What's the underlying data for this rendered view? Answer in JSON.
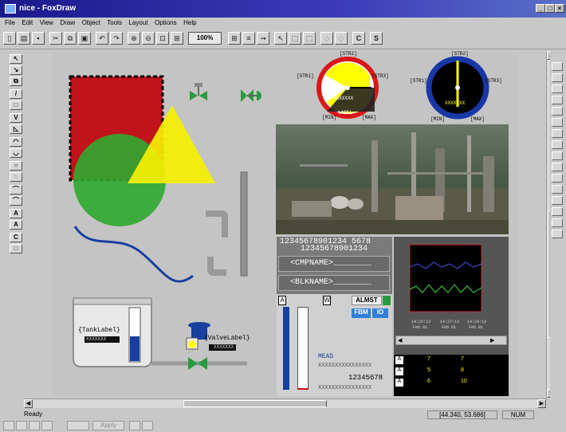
{
  "window": {
    "title": "nice - FoxDraw",
    "min": "_",
    "max": "□",
    "close": "×"
  },
  "menu": [
    "File",
    "Edit",
    "View",
    "Draw",
    "Object",
    "Tools",
    "Layout",
    "Options",
    "Help"
  ],
  "toolbar": {
    "zoom": "100%",
    "btn_c": "C",
    "btn_s": "S"
  },
  "left_tools": [
    "↖",
    "↘",
    "⧉",
    "/",
    "□",
    "V",
    "◺",
    "◠",
    "◡",
    "○",
    "◌",
    "⌒",
    "⌒",
    "A",
    "A",
    "C",
    "□"
  ],
  "gauge1": {
    "top": "[STR2]",
    "left": "[STR1]",
    "right": "[STR3]",
    "bottom_left": "[MIN]",
    "bottom_right": "[MAX]",
    "value": "XXXXXXX",
    "label": "LABEL",
    "ring_color": "#d81818",
    "fill_color": "#ffff00"
  },
  "gauge2": {
    "top": "[STR2]",
    "left": "[STR1]",
    "right": "[STR3]",
    "bottom_left": "[MIN]",
    "bottom_right": "[MAX]",
    "value": "XXXXXXX",
    "ring_color": "#1838a8"
  },
  "panel": {
    "digits1": "12345678901234 5678",
    "digits2": "12345678901234",
    "cmp": "<CMPNAME>________",
    "blk": "<BLKNAME>________"
  },
  "table1": {
    "a_label": "A",
    "w_label": "W",
    "almst": "ALMST",
    "fbm": "FBM",
    "io": "IO",
    "meas": "MEAS",
    "meas_val": "XXXXXXXXXXXXXXXX",
    "number": "12345678",
    "bottom_val": "XXXXXXXXXXXXXXXX"
  },
  "trend": {
    "t1": "14:25:13",
    "t2": "14:27:13",
    "t3": "14:29:13",
    "d1": "Feb 01",
    "d2": "Feb 01",
    "d3": "Feb 01"
  },
  "table2": {
    "rows": [
      {
        "a": "A",
        "v1": "7",
        "v2": "7"
      },
      {
        "a": "A",
        "v1": "5",
        "v2": "8"
      },
      {
        "a": "A",
        "v1": "6",
        "v2": "10"
      }
    ],
    "head_a": "A"
  },
  "tank": {
    "label": "{TankLabel}",
    "value": "XXXXXXX"
  },
  "valve": {
    "label": "{ValveLabel}",
    "value": "XXXXXXX"
  },
  "status": {
    "left": "Ready",
    "coords": "[44.340, 53.686]",
    "num": "NUM"
  },
  "bottom": {
    "apply": "Apply"
  },
  "colors": {
    "red": "#c0141a",
    "yellow": "#f8f000",
    "green": "#30a830",
    "blue": "#1840a0"
  }
}
